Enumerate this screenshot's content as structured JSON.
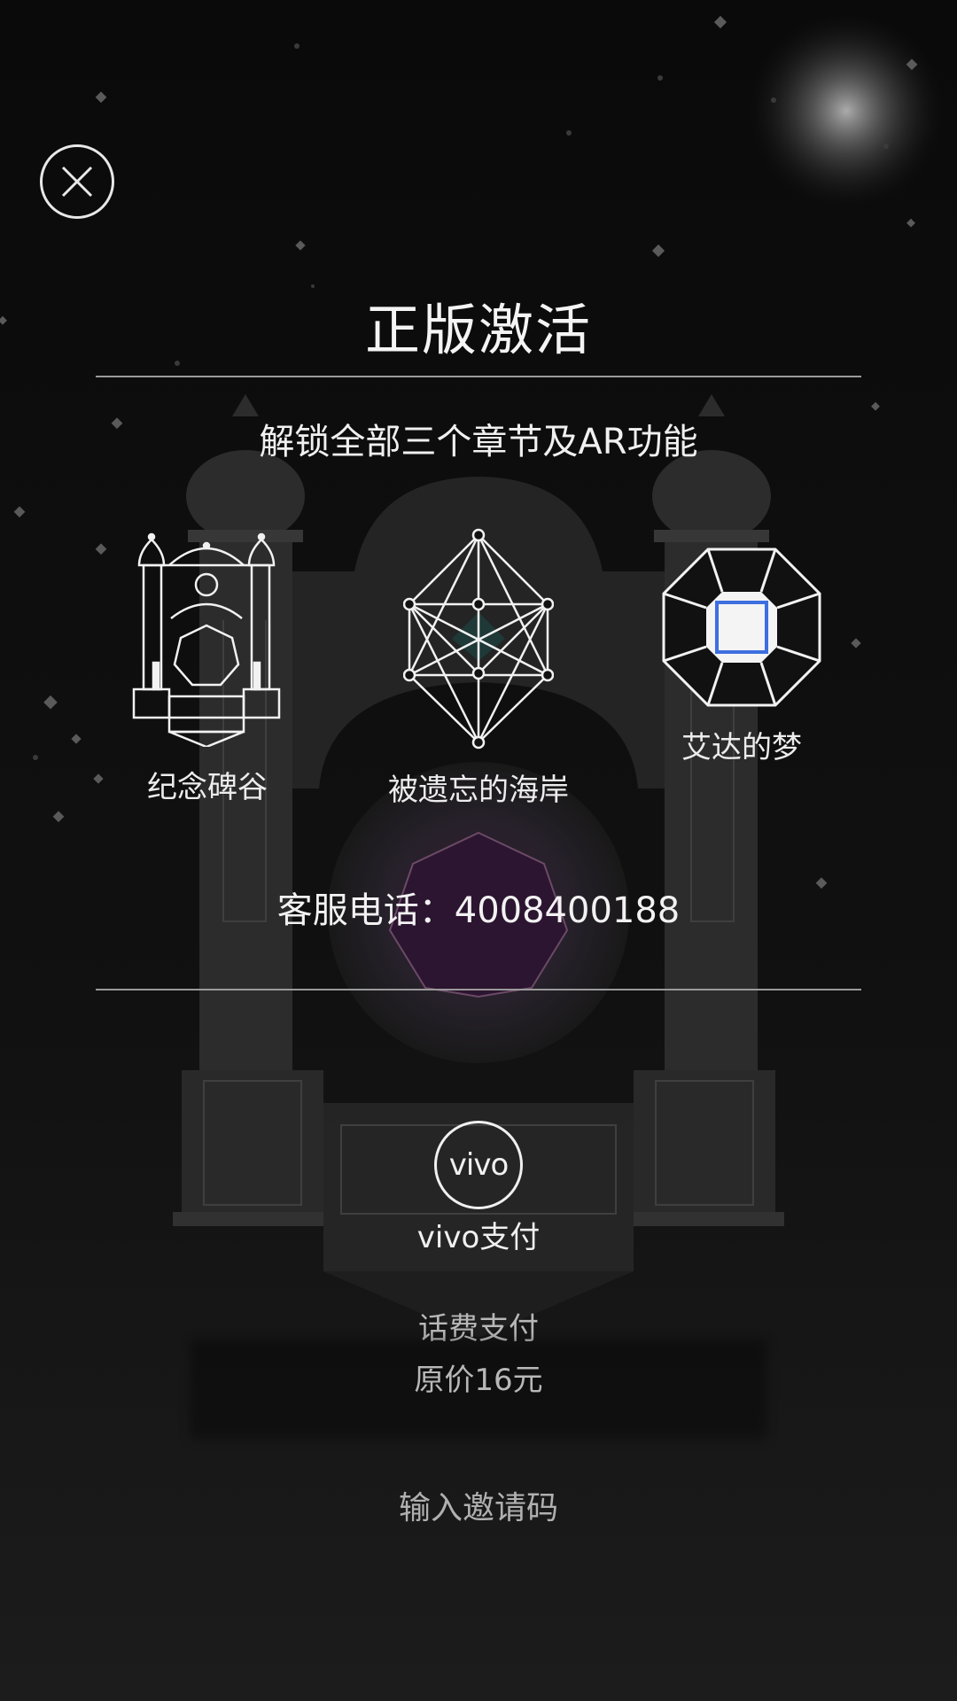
{
  "dialog": {
    "title": "正版激活",
    "subtitle": "解锁全部三个章节及AR功能",
    "chapters": [
      {
        "name": "纪念碑谷",
        "icon": "monument-temple-icon"
      },
      {
        "name": "被遗忘的海岸",
        "icon": "geometric-crystal-icon"
      },
      {
        "name": "艾达的梦",
        "icon": "octagon-box-icon"
      }
    ],
    "phone_text": "客服电话：4008400188"
  },
  "payment": {
    "vivo_logo": "vivo",
    "vivo_label": "vivo支付",
    "phone_pay_label": "话费支付",
    "price_label": "原价16元",
    "invite_label": "输入邀请码"
  },
  "icons": {
    "close": "close-icon",
    "vivo": "vivo-logo-icon"
  },
  "colors": {
    "background": "#0d0d0d",
    "accent_blue": "#3d6fe0",
    "text": "#eeeeee",
    "muted_text": "#b8b8b8"
  }
}
